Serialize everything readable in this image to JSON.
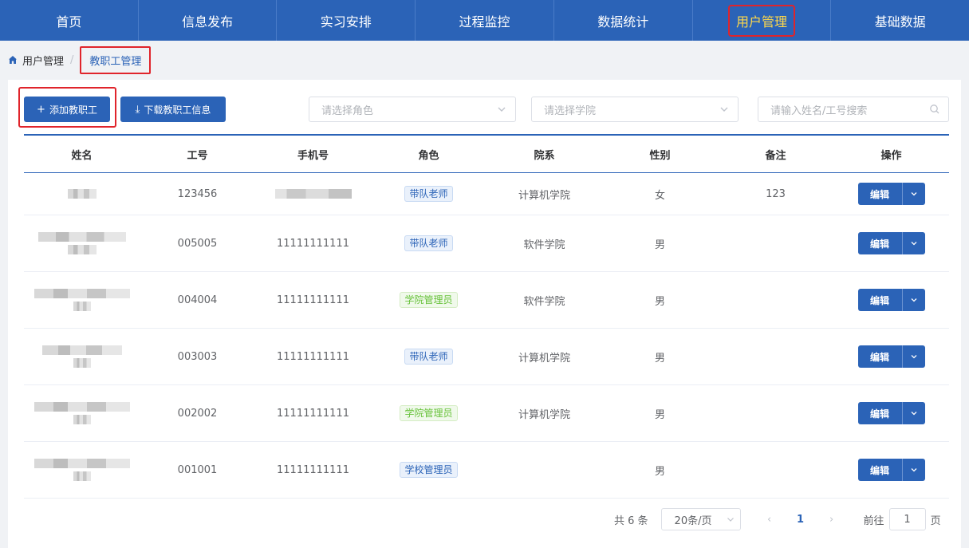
{
  "nav": {
    "items": [
      "首页",
      "信息发布",
      "实习安排",
      "过程监控",
      "数据统计",
      "用户管理",
      "基础数据"
    ],
    "active_index": 5
  },
  "breadcrumb": {
    "parent": "用户管理",
    "separator": "/",
    "current": "教职工管理"
  },
  "toolbar": {
    "add_label": "添加教职工",
    "add_icon": "+",
    "download_label": "下载教职工信息",
    "download_icon": "⤓"
  },
  "filters": {
    "role_placeholder": "请选择角色",
    "college_placeholder": "请选择学院",
    "search_placeholder": "请输入姓名/工号搜索"
  },
  "table": {
    "columns": [
      "姓名",
      "工号",
      "手机号",
      "角色",
      "院系",
      "性别",
      "备注",
      "操作"
    ],
    "rows": [
      {
        "id": "123456",
        "phone": "",
        "role": "带队老师",
        "role_color": "blue",
        "dept": "计算机学院",
        "gender": "女",
        "note": "123"
      },
      {
        "id": "005005",
        "phone": "11111111111",
        "role": "带队老师",
        "role_color": "blue",
        "dept": "软件学院",
        "gender": "男",
        "note": ""
      },
      {
        "id": "004004",
        "phone": "11111111111",
        "role": "学院管理员",
        "role_color": "green",
        "dept": "软件学院",
        "gender": "男",
        "note": ""
      },
      {
        "id": "003003",
        "phone": "11111111111",
        "role": "带队老师",
        "role_color": "blue",
        "dept": "计算机学院",
        "gender": "男",
        "note": ""
      },
      {
        "id": "002002",
        "phone": "11111111111",
        "role": "学院管理员",
        "role_color": "green",
        "dept": "计算机学院",
        "gender": "男",
        "note": ""
      },
      {
        "id": "001001",
        "phone": "11111111111",
        "role": "学校管理员",
        "role_color": "blue",
        "dept": "",
        "gender": "男",
        "note": ""
      }
    ],
    "edit_label": "编辑"
  },
  "pagination": {
    "total": "共 6 条",
    "page_size": "20条/页",
    "prev": "‹",
    "next": "›",
    "current_page": "1",
    "jump_prefix": "前往",
    "jump_value": "1",
    "jump_suffix": "页"
  },
  "colors": {
    "primary": "#2b63b7",
    "highlight": "#ffd84a",
    "annotation": "#e0242b"
  }
}
